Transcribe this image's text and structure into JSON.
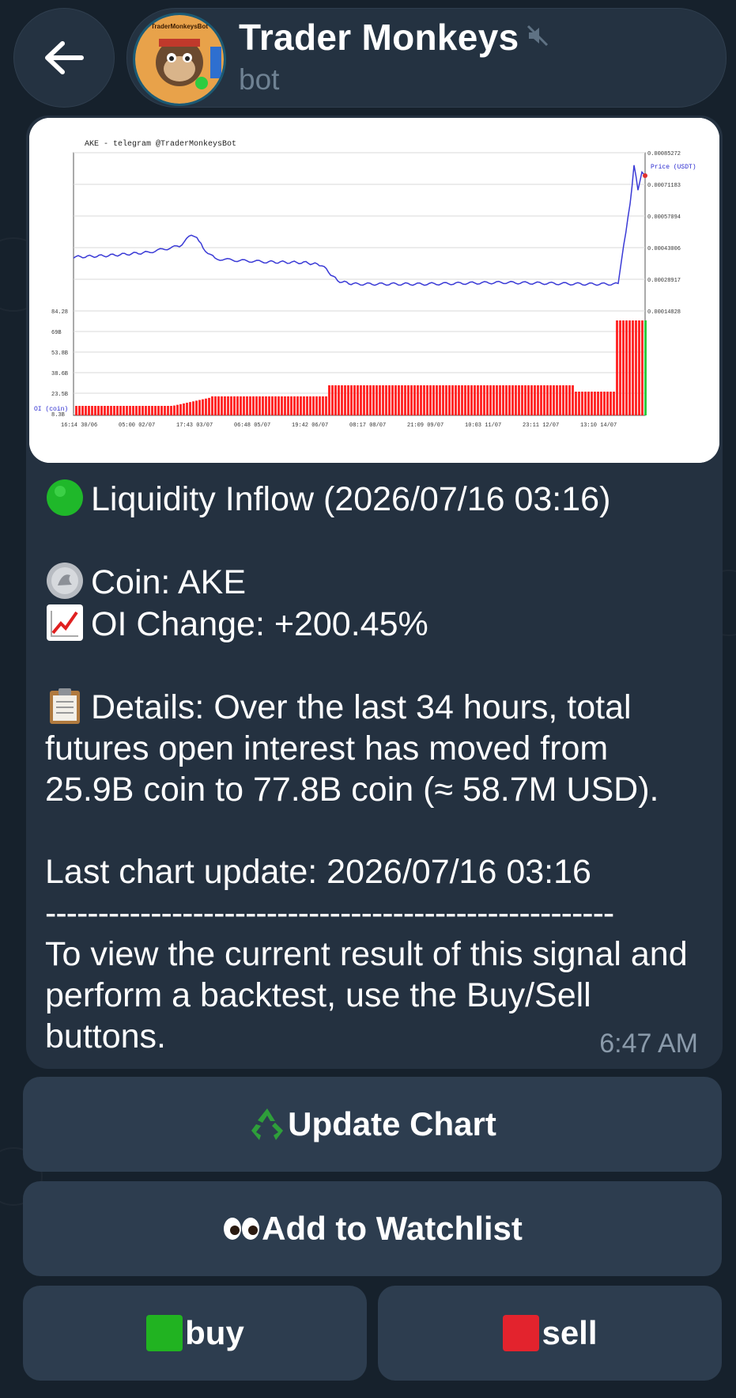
{
  "header": {
    "title": "Trader Monkeys",
    "subtitle": "bot",
    "avatar_text": "TraderMonkeysBot"
  },
  "message": {
    "chart_image": {
      "title": "AKE - telegram @TraderMonkeysBot",
      "price_label": "Price (USDT)",
      "oi_label": "OI (coin)",
      "price_ticks": [
        "0.00085272",
        "0.00071183",
        "0.00057094",
        "0.00043006",
        "0.00028917",
        "0.00014828"
      ],
      "oi_ticks": [
        "84.28",
        "69B",
        "53.8B",
        "38.6B",
        "23.5B",
        "8.3B"
      ],
      "time_ticks": [
        "16:14 30/06",
        "05:00 02/07",
        "17:43 03/07",
        "06:48 05/07",
        "19:42 06/07",
        "08:17 08/07",
        "21:09 09/07",
        "10:03 11/07",
        "23:11 12/07",
        "13:10 14/07"
      ]
    },
    "headline": "Liquidity Inflow (2026/07/16 03:16)",
    "coin_line": "Coin: AKE",
    "oi_change_line": "OI Change: +200.45%",
    "details_line": "Details: Over the last 34 hours, total futures open interest has moved from 25.9B coin to 77.8B coin (≈ 58.7M USD).",
    "last_update_line": "Last chart update: 2026/07/16 03:16",
    "divider": "------------------------------------------------------",
    "footer_text": "To view the current result of this signal and perform a backtest, use the Buy/Sell buttons.",
    "time": "6:47 AM"
  },
  "keyboard": {
    "update_chart": "Update Chart",
    "watchlist": "Add to Watchlist",
    "buy": "buy",
    "sell": "sell"
  },
  "colors": {
    "background": "#16212c",
    "bubble": "#243140",
    "button": "#2d3d4f",
    "price_line": "#3a3ad6",
    "oi_bars": "#ff2a2a"
  }
}
